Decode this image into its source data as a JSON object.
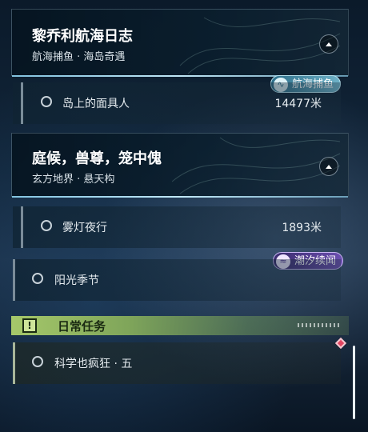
{
  "quest_groups": [
    {
      "title": "黎乔利航海日志",
      "subtitle": "航海捕鱼 · 海岛奇遇",
      "tag": {
        "label": "航海捕鱼",
        "icon": "fishing-icon"
      },
      "tasks": [
        {
          "name": "岛上的面具人",
          "distance": "14477米"
        }
      ]
    },
    {
      "title": "庭候，兽尊，笼中傀",
      "subtitle": "玄方地界 · 悬天构",
      "tag": {
        "label": "潮汐续闻",
        "icon": "wave-icon"
      },
      "tasks": [
        {
          "name": "雾灯夜行",
          "distance": "1893米"
        },
        {
          "name": "阳光季节",
          "distance": ""
        }
      ]
    }
  ],
  "daily": {
    "header_label": "日常任务",
    "icon": "exclamation-icon",
    "tasks": [
      {
        "name": "科学也疯狂 · 五"
      }
    ]
  },
  "colors": {
    "accent_line": "#a8e0f2",
    "daily_header": "#a6c86a",
    "marker": "#e34561"
  }
}
